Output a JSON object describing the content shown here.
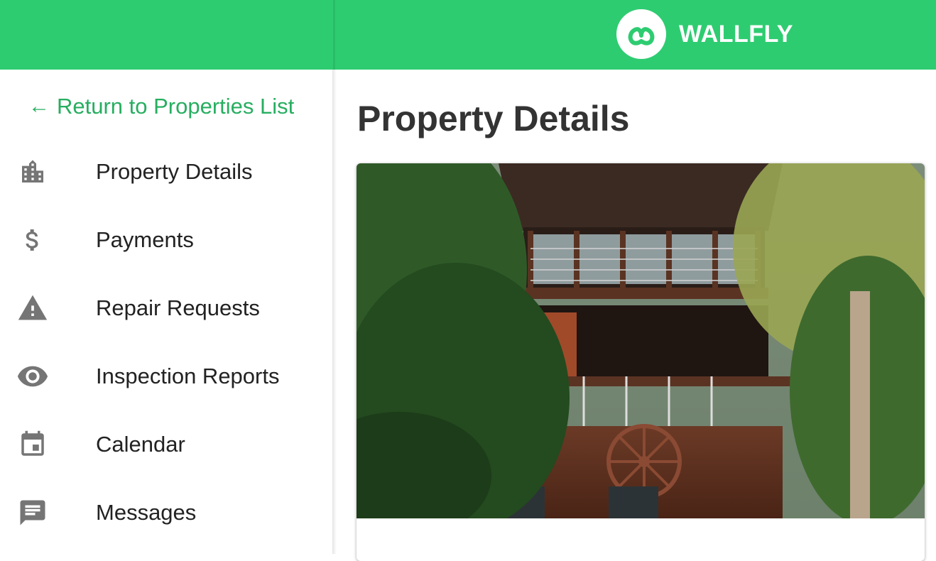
{
  "brand": {
    "name": "WALLFLY",
    "logo_icon": "wallfly-logo-icon",
    "color": "#2ecc71"
  },
  "sidebar": {
    "return_link": {
      "arrow": "←",
      "label": "Return to Properties List"
    },
    "items": [
      {
        "label": "Property Details",
        "icon": "building-icon"
      },
      {
        "label": "Payments",
        "icon": "dollar-icon"
      },
      {
        "label": "Repair Requests",
        "icon": "warning-icon"
      },
      {
        "label": "Inspection Reports",
        "icon": "eye-icon"
      },
      {
        "label": "Calendar",
        "icon": "calendar-icon"
      },
      {
        "label": "Messages",
        "icon": "message-icon"
      }
    ]
  },
  "main": {
    "title": "Property Details",
    "card": {
      "image": "property-photo"
    }
  },
  "colors": {
    "accent": "#2ecc71",
    "link": "#27ae60",
    "icon": "#757575",
    "title": "#333333"
  }
}
